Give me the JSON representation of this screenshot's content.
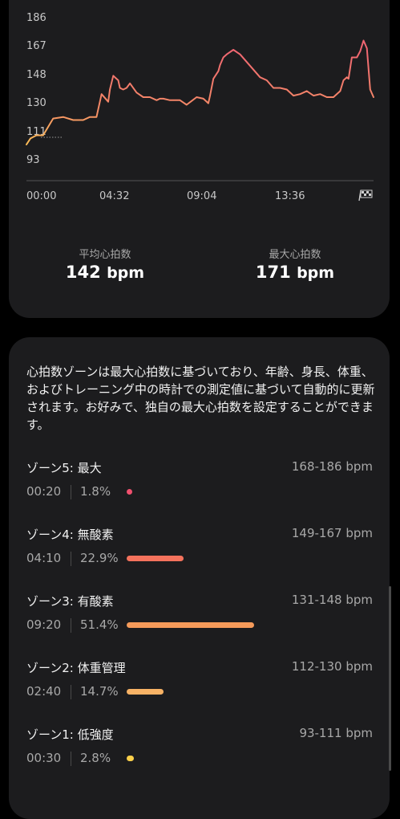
{
  "chart": {
    "y_ticks": [
      "186",
      "167",
      "148",
      "130",
      "111",
      "93"
    ],
    "x_ticks": [
      "00:00",
      "04:32",
      "09:04",
      "13:36"
    ],
    "end_icon": "finish-flag-icon"
  },
  "chart_data": {
    "type": "line",
    "xlabel": "",
    "ylabel": "",
    "x_unit": "minutes",
    "ylim": [
      93,
      186
    ],
    "xlim": [
      0,
      1040
    ],
    "x": [
      0,
      12,
      30,
      50,
      80,
      110,
      140,
      170,
      190,
      210,
      225,
      245,
      250,
      260,
      265,
      275,
      280,
      290,
      300,
      310,
      330,
      350,
      370,
      390,
      400,
      410,
      430,
      460,
      480,
      510,
      530,
      545,
      550,
      560,
      575,
      580,
      590,
      600,
      620,
      640,
      660,
      680,
      700,
      720,
      740,
      760,
      780,
      800,
      820,
      840,
      860,
      880,
      900,
      920,
      940,
      950,
      960,
      965,
      975,
      990,
      1000,
      1010,
      1020,
      1030,
      1040
    ],
    "y": [
      103,
      107,
      109,
      109,
      120,
      121,
      119,
      119,
      121,
      121,
      136,
      131,
      139,
      148,
      147,
      145,
      140,
      139,
      140,
      143,
      137,
      134,
      134,
      132,
      133,
      133,
      132,
      132,
      129,
      134,
      133,
      130,
      135,
      146,
      151,
      155,
      160,
      162,
      165,
      162,
      157,
      152,
      147,
      145,
      140,
      140,
      139,
      135,
      136,
      138,
      135,
      136,
      134,
      134,
      138,
      145,
      147,
      146,
      160,
      160,
      164,
      171,
      166,
      139,
      134
    ],
    "colors": {
      "low": "#ffd54f",
      "high": "#f06572",
      "mid": "#f48b66"
    }
  },
  "stats": {
    "avg_label": "平均心拍数",
    "avg_value": "142",
    "max_label": "最大心拍数",
    "max_value": "171",
    "unit": "bpm"
  },
  "zones_card": {
    "description": "心拍数ゾーンは最大心拍数に基づいており、年齢、身長、体重、およびトレーニング中の時計での測定値に基づいて自動的に更新されます。お好みで、独自の最大心拍数を設定することができます。",
    "zones": [
      {
        "name": "ゾーン5: 最大",
        "range": "168-186 bpm",
        "time": "00:20",
        "percent": "1.8%",
        "fraction": 0.018,
        "color": "#f0506e"
      },
      {
        "name": "ゾーン4: 無酸素",
        "range": "149-167 bpm",
        "time": "04:10",
        "percent": "22.9%",
        "fraction": 0.229,
        "color": "#f4725c"
      },
      {
        "name": "ゾーン3: 有酸素",
        "range": "131-148 bpm",
        "time": "09:20",
        "percent": "51.4%",
        "fraction": 0.514,
        "color": "#f59a5a"
      },
      {
        "name": "ゾーン2: 体重管理",
        "range": "112-130 bpm",
        "time": "02:40",
        "percent": "14.7%",
        "fraction": 0.147,
        "color": "#f7b265"
      },
      {
        "name": "ゾーン1: 低強度",
        "range": "93-111 bpm",
        "time": "00:30",
        "percent": "2.8%",
        "fraction": 0.028,
        "color": "#fcd04a"
      }
    ]
  }
}
